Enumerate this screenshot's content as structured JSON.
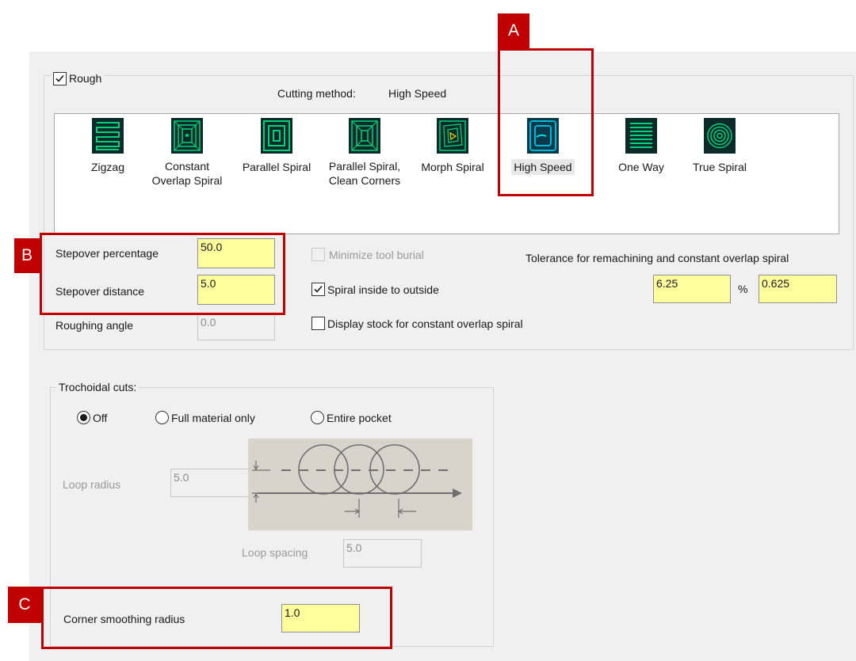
{
  "rough": {
    "checkbox_label": "Rough",
    "checked": true,
    "cutting_method_label": "Cutting method:",
    "cutting_method_value": "High Speed",
    "methods": [
      {
        "line1": "Zigzag",
        "line2": "",
        "icon": "zigzag-icon"
      },
      {
        "line1": "Constant",
        "line2": "Overlap Spiral",
        "icon": "constant-overlap-spiral-icon"
      },
      {
        "line1": "Parallel Spiral",
        "line2": "",
        "icon": "parallel-spiral-icon"
      },
      {
        "line1": "Parallel Spiral,",
        "line2": "Clean Corners",
        "icon": "parallel-spiral-clean-corners-icon"
      },
      {
        "line1": "Morph Spiral",
        "line2": "",
        "icon": "morph-spiral-icon"
      },
      {
        "line1": "High Speed",
        "line2": "",
        "icon": "high-speed-icon"
      },
      {
        "line1": "One Way",
        "line2": "",
        "icon": "one-way-icon"
      },
      {
        "line1": "True Spiral",
        "line2": "",
        "icon": "true-spiral-icon"
      }
    ],
    "selected_method": "High Speed",
    "stepover_percentage": {
      "label": "Stepover percentage",
      "value": "50.0"
    },
    "stepover_distance": {
      "label": "Stepover distance",
      "value": "5.0"
    },
    "roughing_angle": {
      "label": "Roughing angle",
      "value": "0.0"
    },
    "minimize_tool_burial": {
      "label": "Minimize tool burial",
      "checked": false,
      "enabled": false
    },
    "spiral_inside_to_outside": {
      "label": "Spiral inside to outside",
      "checked": true
    },
    "display_stock": {
      "label": "Display stock for constant overlap spiral",
      "checked": false
    },
    "tolerance": {
      "label": "Tolerance for remachining and constant overlap spiral",
      "percent_value": "6.25",
      "percent_unit": "%",
      "distance_value": "0.625"
    }
  },
  "trochoidal": {
    "legend": "Trochoidal cuts:",
    "options": [
      "Off",
      "Full material only",
      "Entire pocket"
    ],
    "selected": "Off",
    "loop_radius": {
      "label": "Loop radius",
      "value": "5.0"
    },
    "loop_spacing": {
      "label": "Loop spacing",
      "value": "5.0"
    },
    "corner_smoothing_radius": {
      "label": "Corner smoothing radius",
      "value": "1.0"
    }
  },
  "callouts": [
    "A",
    "B",
    "C"
  ],
  "colors": {
    "callout_red": "#c00000",
    "field_yellow": "#fefe9c",
    "icon_green": "#00c878",
    "icon_bg": "#0b2a2a"
  }
}
